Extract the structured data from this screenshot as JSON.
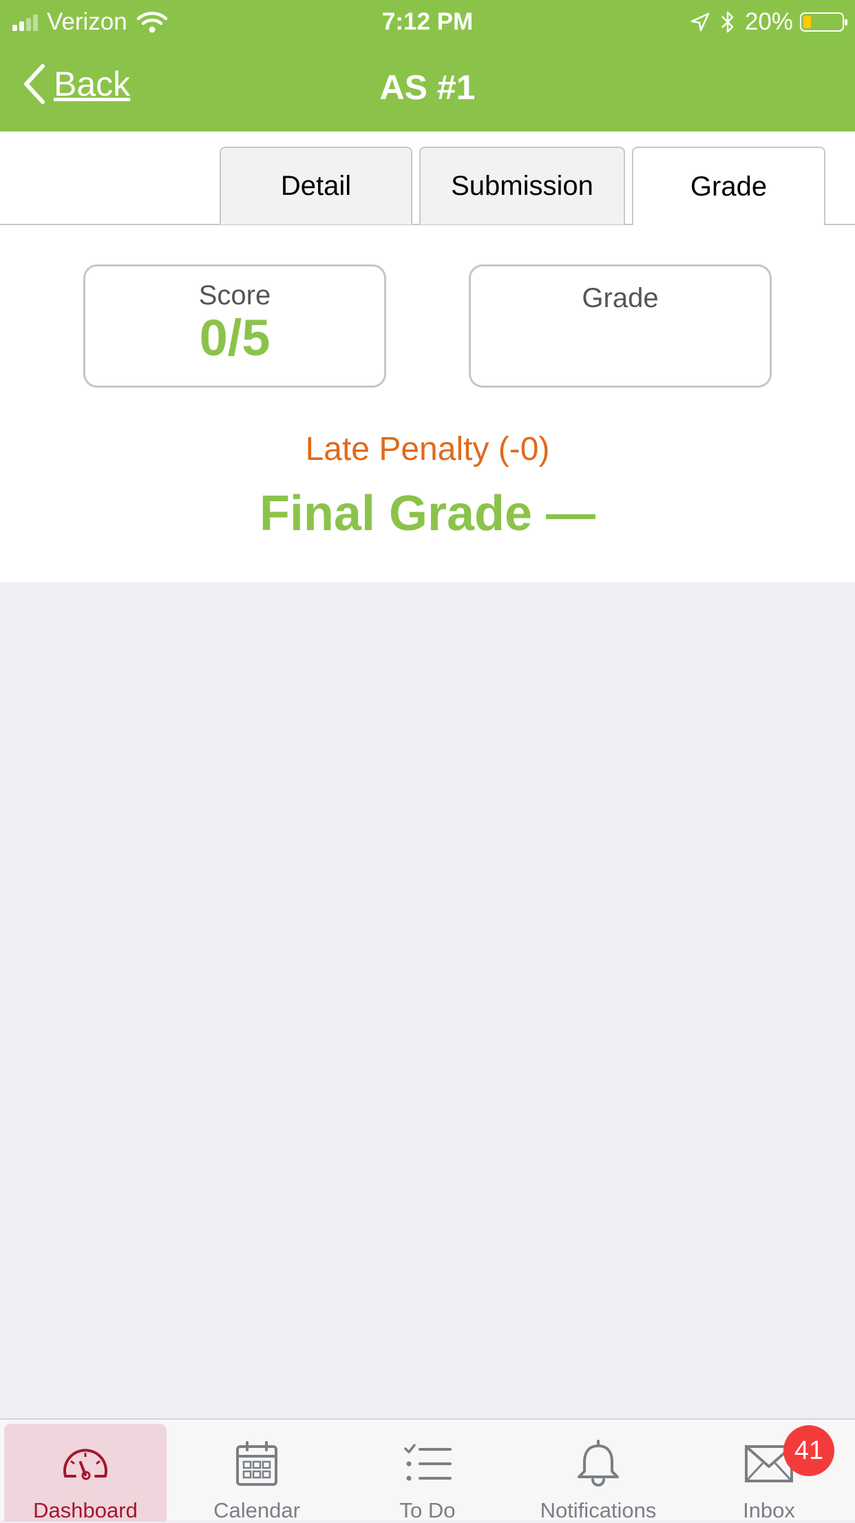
{
  "status_bar": {
    "carrier": "Verizon",
    "time": "7:12 PM",
    "battery_percent": "20%",
    "battery_level": 0.2,
    "battery_color": "#ffcc00",
    "icons": [
      "signal-icon",
      "wifi-icon",
      "location-arrow-icon",
      "bluetooth-icon",
      "battery-icon"
    ]
  },
  "nav": {
    "back_label": "Back",
    "title": "AS #1",
    "color": "#8bc34a"
  },
  "tabs": [
    {
      "label": "Detail",
      "active": false
    },
    {
      "label": "Submission",
      "active": false
    },
    {
      "label": "Grade",
      "active": true
    }
  ],
  "grade_panel": {
    "score_label": "Score",
    "score_value": "0/5",
    "grade_label": "Grade",
    "grade_value": "",
    "late_penalty": "Late Penalty (-0)",
    "final_grade": "Final Grade —"
  },
  "colors": {
    "accent_green": "#8bc34a",
    "penalty_orange": "#e06a1b",
    "active_tab_red": "#a3172f",
    "badge_red": "#f43b3b"
  },
  "tab_bar": {
    "items": [
      {
        "label": "Dashboard",
        "icon": "dashboard-gauge-icon",
        "active": true
      },
      {
        "label": "Calendar",
        "icon": "calendar-icon",
        "active": false
      },
      {
        "label": "To Do",
        "icon": "todo-list-icon",
        "active": false
      },
      {
        "label": "Notifications",
        "icon": "bell-icon",
        "active": false
      },
      {
        "label": "Inbox",
        "icon": "envelope-icon",
        "active": false
      }
    ],
    "inbox_badge": "41"
  }
}
